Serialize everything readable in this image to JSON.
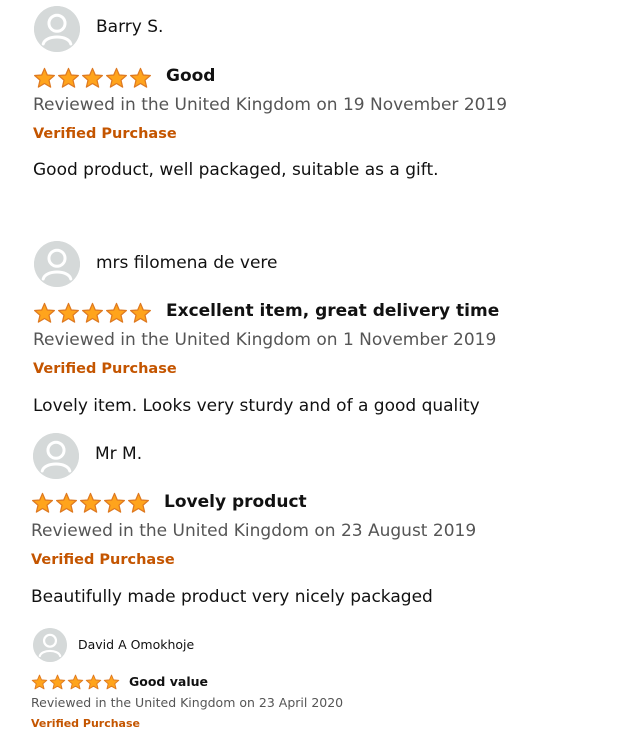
{
  "colors": {
    "star_fill": "#FFA41C",
    "star_stroke": "#DE7921",
    "verified": "#C45500",
    "meta": "#555555",
    "avatar_bg": "#D5D9D9",
    "avatar_fg": "#FFFFFF"
  },
  "icons": {
    "avatar": "user-silhouette-icon",
    "star": "star-icon"
  },
  "reviews": [
    {
      "reviewer": "Barry S.",
      "rating": 5,
      "title": "Good",
      "meta": "Reviewed in the United Kingdom on 19 November 2019",
      "verified": "Verified Purchase",
      "body": "Good product, well packaged, suitable as a gift."
    },
    {
      "reviewer": "mrs filomena de vere",
      "rating": 5,
      "title": "Excellent item, great delivery time",
      "meta": "Reviewed in the United Kingdom on 1 November 2019",
      "verified": "Verified Purchase",
      "body": "Lovely item. Looks very sturdy and of a good quality"
    },
    {
      "reviewer": "Mr M.",
      "rating": 5,
      "title": "Lovely product",
      "meta": "Reviewed in the United Kingdom on 23 August 2019",
      "verified": "Verified Purchase",
      "body": "Beautifully made product very nicely packaged"
    },
    {
      "reviewer": "David A Omokhoje",
      "rating": 5,
      "title": "Good value",
      "meta": "Reviewed in the United Kingdom on 23 April 2020",
      "verified": "Verified Purchase"
    }
  ]
}
